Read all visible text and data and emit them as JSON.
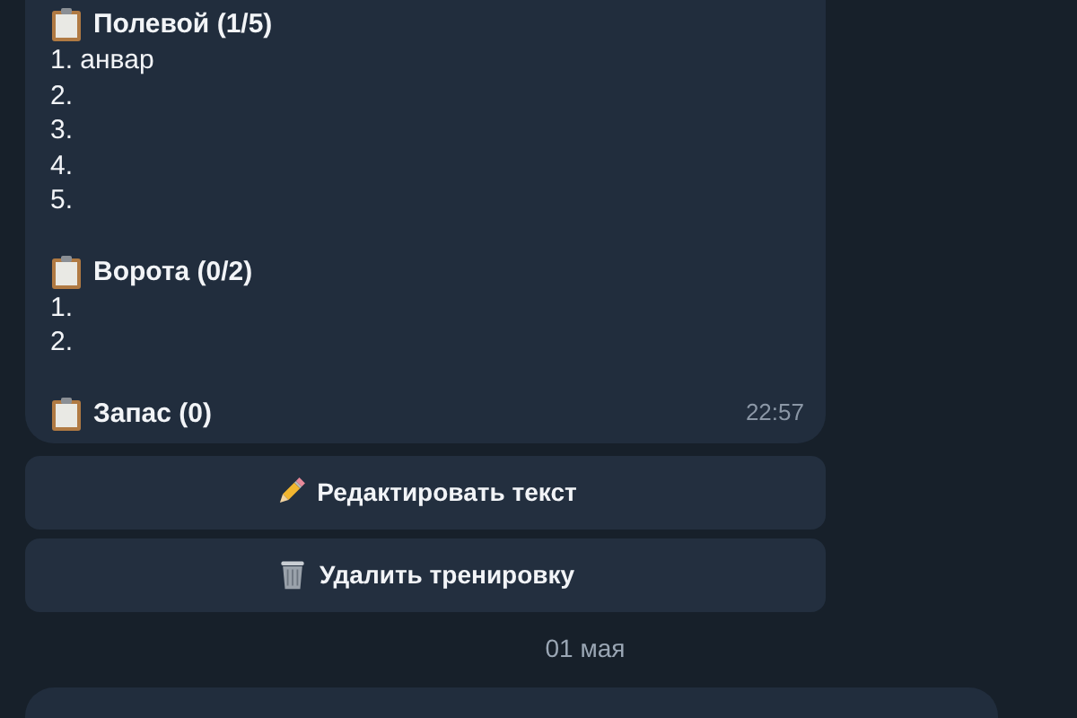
{
  "message": {
    "sections": [
      {
        "title": "Полевой (1/5)",
        "entries": [
          "1. анвар",
          "2.",
          "3.",
          "4.",
          "5."
        ]
      },
      {
        "title": "Ворота (0/2)",
        "entries": [
          "1.",
          "2."
        ]
      },
      {
        "title": "Запас (0)"
      }
    ],
    "time": "22:57"
  },
  "buttons": [
    {
      "label": "Редактировать текст",
      "kind": "edit"
    },
    {
      "label": "Удалить тренировку",
      "kind": "delete"
    }
  ],
  "date_separator": "01 мая"
}
